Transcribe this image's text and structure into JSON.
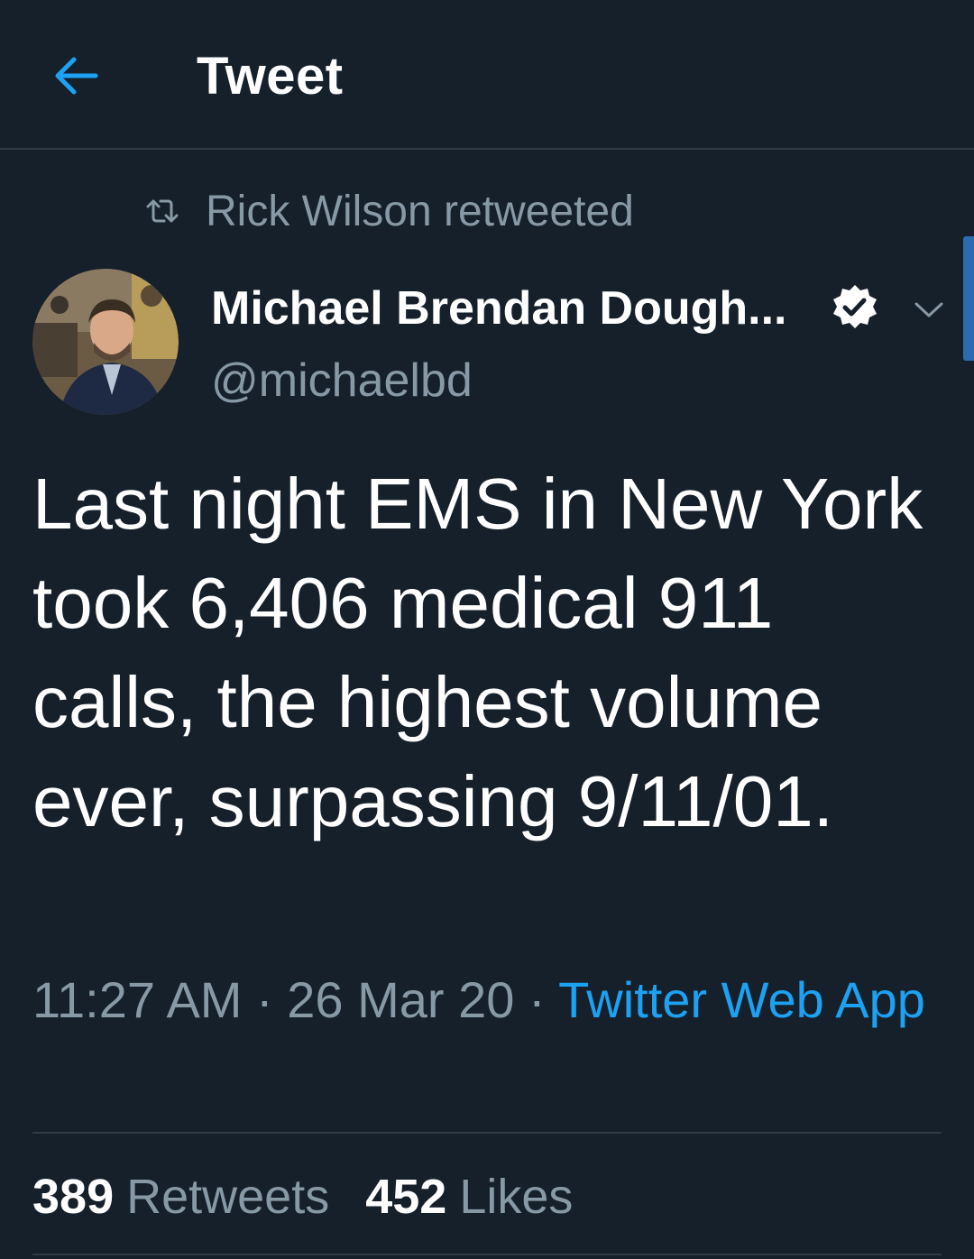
{
  "header": {
    "title": "Tweet",
    "back_icon": "arrow-left-icon"
  },
  "colors": {
    "background": "#16202b",
    "accent": "#1da1f2",
    "secondary_text": "#8899a6",
    "divider": "#2f3b47"
  },
  "social_context": {
    "icon": "retweet-icon",
    "text": "Rick Wilson retweeted"
  },
  "author": {
    "name": "Michael Brendan Dough...",
    "handle": "@michaelbd",
    "verified": true,
    "avatar_icon": "avatar-photo"
  },
  "tweet": {
    "text": "Last night EMS in New York took 6,406 medical 911 calls, the highest volume ever, surpassing 9/11/01.",
    "time": "11:27 AM",
    "date": "26 Mar 20",
    "separator": "·",
    "source": "Twitter Web App"
  },
  "stats": {
    "retweets_count": "389",
    "retweets_label": "Retweets",
    "likes_count": "452",
    "likes_label": "Likes"
  }
}
